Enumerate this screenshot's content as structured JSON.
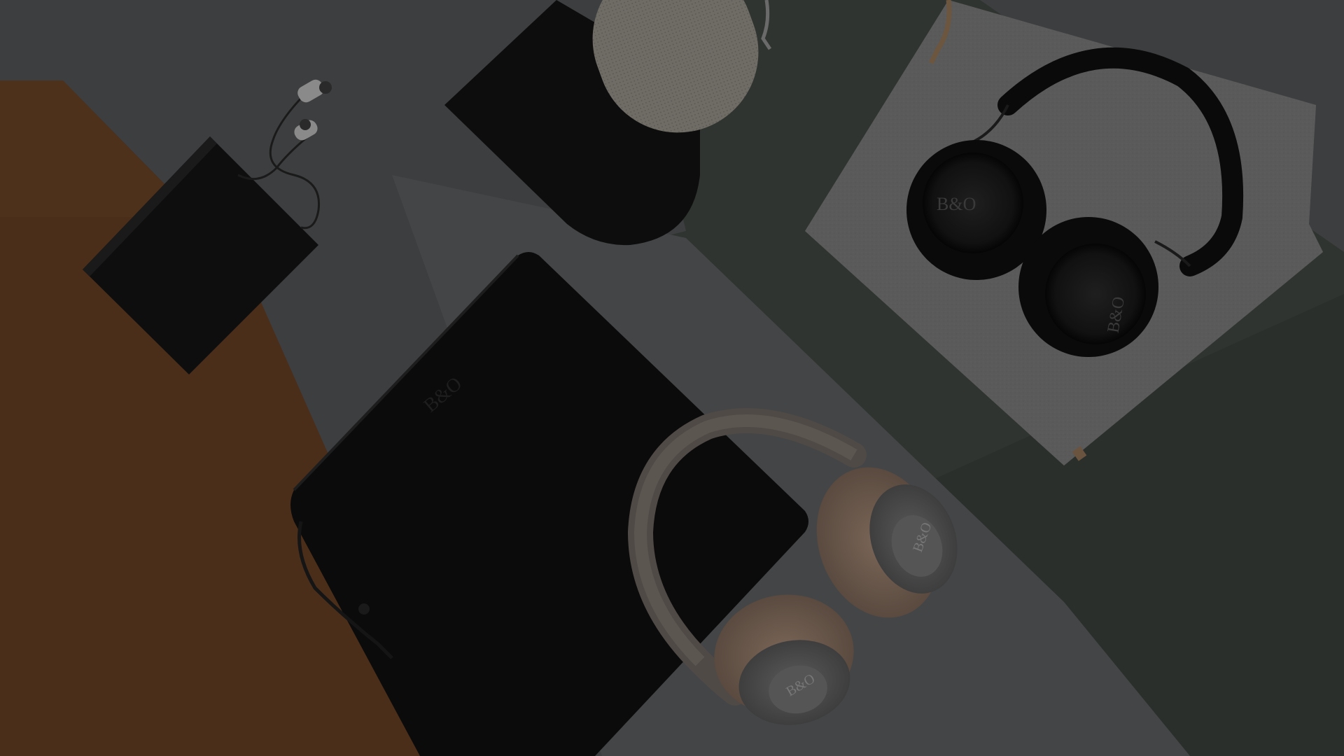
{
  "colors": {
    "background_grey": "#3d3e40",
    "tan_panel": "#4a2e1a",
    "dark_green_panel": "#2f3430",
    "felt_grey": "#5a5a5a",
    "leather_black": "#0c0c0c",
    "speaker_beige": "#6e6a64",
    "headphone_tan": "#6b5a4e",
    "headphone_grey": "#4a4a4a",
    "earphone_silver": "#8a8a8a"
  },
  "objects": [
    "earphones-icon",
    "card-wallet-icon",
    "speaker-pouch-icon",
    "portable-speaker-icon",
    "laptop-sleeve-icon",
    "tan-headphones-icon",
    "black-headphones-icon",
    "felt-tablet-sleeve-icon"
  ]
}
